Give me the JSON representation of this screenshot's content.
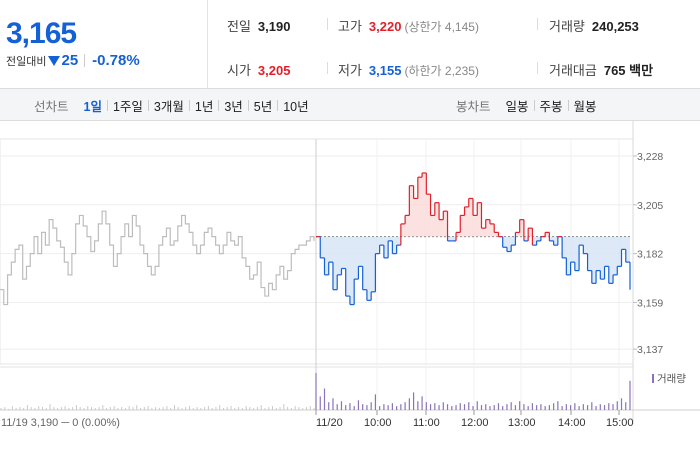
{
  "summary": {
    "price": "3,165",
    "change_label": "전일대비",
    "change_abs": "25",
    "change_pct": "-0.78%",
    "prev_close": {
      "label": "전일",
      "value": "3,190"
    },
    "open": {
      "label": "시가",
      "value": "3,205"
    },
    "high": {
      "label": "고가",
      "value": "3,220",
      "sub": "(상한가 4,145)"
    },
    "low": {
      "label": "저가",
      "value": "3,155",
      "sub": "(하한가 2,235)"
    },
    "volume": {
      "label": "거래량",
      "value": "240,253"
    },
    "trade_value": {
      "label": "거래대금",
      "value": "765",
      "unit": "백만"
    }
  },
  "toolbar": {
    "line_label": "선차트",
    "line_options": [
      "1일",
      "1주일",
      "3개월",
      "1년",
      "3년",
      "5년",
      "10년"
    ],
    "line_active": "1일",
    "candle_label": "봉차트",
    "candle_options": [
      "일봉",
      "주봉",
      "월봉"
    ]
  },
  "colors": {
    "up": "#e0202a",
    "down": "#1461d6",
    "prev_day": "#bdbdbd",
    "up_fill": "#fbd9da",
    "down_fill": "#d6e4f5",
    "volume": "#8a73b8",
    "volume_prev": "#c8c8c8"
  },
  "chart_data": {
    "type": "line",
    "y_ticks": [
      "3,228",
      "3,205",
      "3,182",
      "3,159",
      "3,137"
    ],
    "y_tick_values": [
      3228,
      3205,
      3182,
      3159,
      3137
    ],
    "ylim": [
      3130,
      3236
    ],
    "baseline": 3190,
    "x_labels": [
      "11/20",
      "10:00",
      "11:00",
      "12:00",
      "13:00",
      "14:00",
      "15:00"
    ],
    "prev_day_label": "11/19  3,190 ─ 0 (0.00%)",
    "volume_legend": "거래량",
    "series": [
      {
        "name": "11/19",
        "values": [
          3165,
          3158,
          3172,
          3178,
          3184,
          3186,
          3170,
          3176,
          3182,
          3190,
          3182,
          3192,
          3186,
          3198,
          3194,
          3188,
          3185,
          3178,
          3172,
          3182,
          3196,
          3200,
          3195,
          3190,
          3183,
          3188,
          3196,
          3202,
          3196,
          3186,
          3176,
          3182,
          3190,
          3196,
          3190,
          3200,
          3195,
          3186,
          3182,
          3176,
          3172,
          3176,
          3186,
          3190,
          3194,
          3186,
          3188,
          3195,
          3200,
          3196,
          3192,
          3186,
          3182,
          3186,
          3192,
          3194,
          3190,
          3186,
          3182,
          3186,
          3192,
          3188,
          3186,
          3190,
          3180,
          3176,
          3170,
          3172,
          3178,
          3166,
          3162,
          3168,
          3165,
          3172,
          3176,
          3170,
          3174,
          3182,
          3184,
          3186,
          3186,
          3188,
          3190,
          3188
        ]
      },
      {
        "name": "11/20",
        "values": [
          3190,
          3180,
          3172,
          3178,
          3165,
          3172,
          3175,
          3162,
          3158,
          3170,
          3176,
          3165,
          3160,
          3164,
          3182,
          3186,
          3180,
          3188,
          3182,
          3186,
          3196,
          3200,
          3214,
          3208,
          3218,
          3220,
          3210,
          3200,
          3206,
          3198,
          3202,
          3188,
          3188,
          3192,
          3200,
          3204,
          3208,
          3200,
          3206,
          3194,
          3198,
          3196,
          3192,
          3190,
          3185,
          3183,
          3186,
          3192,
          3198,
          3188,
          3194,
          3186,
          3188,
          3190,
          3192,
          3188,
          3186,
          3190,
          3180,
          3172,
          3178,
          3174,
          3186,
          3182,
          3174,
          3168,
          3174,
          3170,
          3176,
          3168,
          3172,
          3176,
          3184,
          3178,
          3165
        ]
      }
    ],
    "volume": {
      "prev_day": [
        2,
        3,
        1,
        4,
        2,
        3,
        2,
        5,
        3,
        2,
        4,
        3,
        2,
        6,
        3,
        2,
        3,
        4,
        2,
        3,
        5,
        3,
        2,
        4,
        3,
        2,
        3,
        5,
        2,
        3,
        4,
        2,
        3,
        2,
        4,
        3,
        5,
        2,
        3,
        4,
        2,
        3,
        2,
        3,
        4,
        2,
        5,
        3,
        2,
        3,
        4,
        2,
        3,
        2,
        3,
        4,
        2,
        3,
        5,
        2,
        3,
        4,
        2,
        3,
        2,
        4,
        3,
        2,
        3,
        5,
        2,
        3,
        4,
        2,
        3,
        6,
        3,
        2,
        4,
        3,
        2,
        3,
        4,
        2
      ],
      "today": [
        38,
        14,
        22,
        8,
        12,
        6,
        9,
        5,
        7,
        4,
        10,
        6,
        5,
        8,
        16,
        4,
        6,
        5,
        7,
        4,
        6,
        8,
        12,
        18,
        9,
        14,
        8,
        6,
        7,
        5,
        8,
        6,
        4,
        5,
        7,
        6,
        8,
        4,
        9,
        5,
        6,
        4,
        5,
        7,
        4,
        6,
        8,
        5,
        9,
        6,
        4,
        7,
        5,
        6,
        4,
        5,
        7,
        9,
        4,
        6,
        5,
        7,
        4,
        6,
        5,
        8,
        4,
        6,
        5,
        7,
        6,
        9,
        12,
        8,
        30
      ]
    }
  }
}
